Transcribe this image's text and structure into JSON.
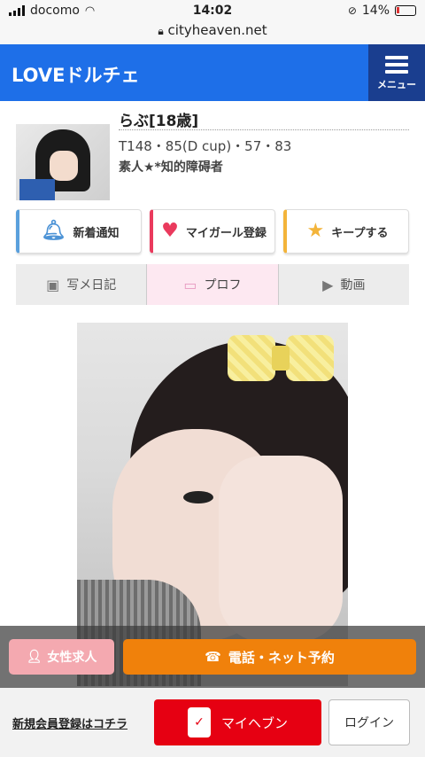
{
  "status": {
    "carrier": "docomo",
    "time": "14:02",
    "battery": "14%"
  },
  "browser": {
    "url": "cityheaven.net"
  },
  "header": {
    "title": "LOVEドルチェ",
    "menu_label": "メニュー"
  },
  "profile": {
    "name": "らぶ[18歳]",
    "stats": "T148・85(D cup)・57・83",
    "tag": "素人★*知的障碍者"
  },
  "actions": [
    {
      "label": "新着通知",
      "icon": "bell-icon",
      "accent": "#5aa0dc"
    },
    {
      "label": "マイガール登録",
      "icon": "heart-icon",
      "accent": "#ea3a5d"
    },
    {
      "label": "キープする",
      "icon": "star-icon",
      "accent": "#f3b43a"
    }
  ],
  "tabs": [
    {
      "label": "写メ日記",
      "icon": "diary-icon"
    },
    {
      "label": "プロフ",
      "icon": "profile-card-icon",
      "active": true
    },
    {
      "label": "動画",
      "icon": "play-icon"
    }
  ],
  "float_bar": {
    "recruit_label": "女性求人",
    "call_label": "電話・ネット予約"
  },
  "bottom_bar": {
    "register_label": "新規会員登録はコチラ",
    "myheaven_label": "マイヘブン",
    "login_label": "ログイン"
  },
  "colors": {
    "header": "#1e6fe8",
    "menu": "#1a3e8f",
    "call": "#f0810b",
    "myheaven": "#e60012",
    "recruit": "#f4a9b0"
  }
}
